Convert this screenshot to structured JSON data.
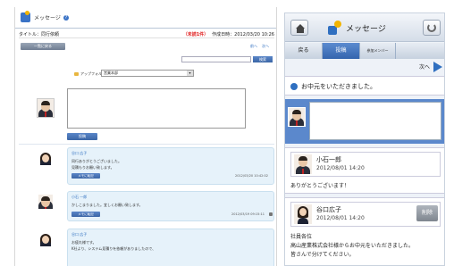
{
  "desktop": {
    "title": "メッセージ",
    "subject": "タイトル：同行依頼",
    "unread": "（未読1件）",
    "meta": "作成日時：2012/03/20 10:26",
    "return_label": "一覧に戻る",
    "pager": [
      "前へ",
      "次へ"
    ],
    "search_button": "検索",
    "folder_label": "アップフォルダ",
    "folder_value": "営業本部",
    "post_button": "投稿",
    "posts": [
      {
        "name": "谷口 広子",
        "lines": [
          "同行ありがとうございました。",
          "見積もりお願い致します。"
        ],
        "reply": "メモに転記",
        "stamp": "2012/03/20 10:42:02"
      },
      {
        "name": "小石 一郎",
        "lines": [
          "かしこまりました。宜しくお願い致します。"
        ],
        "reply": "メモに転記",
        "stamp": "2012/03/19 09:15:11"
      },
      {
        "name": "谷口 広子",
        "lines": [
          "お疲れ様です。",
          "K社より、システム見積りを依頼がありましたので、"
        ],
        "reply": "",
        "stamp": ""
      }
    ]
  },
  "mobile": {
    "title": "メッセージ",
    "tabs": [
      "戻る",
      "投稿",
      "参加メンバー"
    ],
    "next_label": "次へ",
    "thread_title": "お中元をいただきました。",
    "posts": [
      {
        "name": "小石一郎",
        "time": "2012/08/01 14:20",
        "body": [
          "ありがとうございます！"
        ],
        "delete": ""
      },
      {
        "name": "谷口広子",
        "time": "2012/08/01 14:20",
        "body": [
          "社員各位",
          "高山産業株式会社様からお中元をいただきました。",
          "皆さんで分けてください。"
        ],
        "delete": "削除"
      }
    ]
  }
}
